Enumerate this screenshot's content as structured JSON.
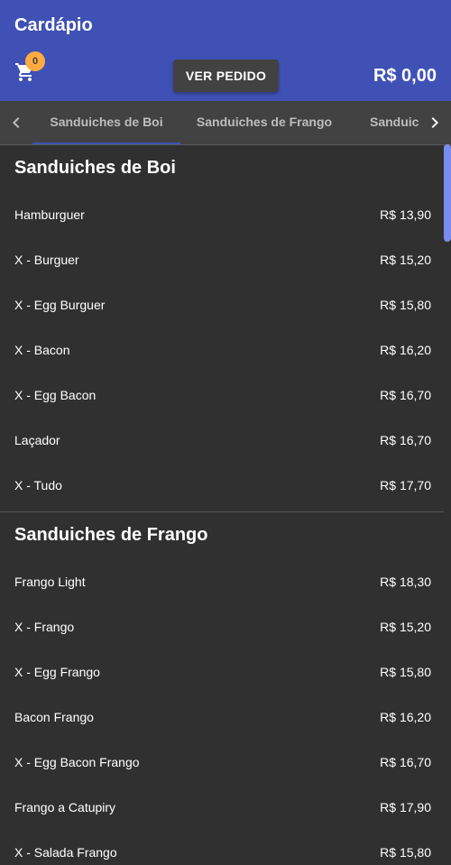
{
  "header": {
    "title": "Cardápio",
    "cart_icon": "cart-icon",
    "cart_count": "0",
    "order_button": "VER PEDIDO",
    "total": "R$ 0,00"
  },
  "tabs": {
    "items": [
      {
        "label": "Sanduiches de Boi",
        "active": true
      },
      {
        "label": "Sanduiches de Frango",
        "active": false
      },
      {
        "label": "Sanduiches",
        "active": false
      }
    ],
    "left_icon": "chevron-left-icon",
    "right_icon": "chevron-right-icon"
  },
  "sections": [
    {
      "title": "Sanduiches de Boi",
      "items": [
        {
          "name": "Hamburguer",
          "price": "R$ 13,90"
        },
        {
          "name": "X - Burguer",
          "price": "R$ 15,20"
        },
        {
          "name": "X - Egg Burguer",
          "price": "R$ 15,80"
        },
        {
          "name": "X - Bacon",
          "price": "R$ 16,20"
        },
        {
          "name": "X - Egg Bacon",
          "price": "R$ 16,70"
        },
        {
          "name": "Laçador",
          "price": "R$ 16,70"
        },
        {
          "name": "X - Tudo",
          "price": "R$ 17,70"
        }
      ]
    },
    {
      "title": "Sanduiches de Frango",
      "items": [
        {
          "name": "Frango Light",
          "price": "R$ 18,30"
        },
        {
          "name": "X - Frango",
          "price": "R$ 15,20"
        },
        {
          "name": "X - Egg Frango",
          "price": "R$ 15,80"
        },
        {
          "name": "Bacon Frango",
          "price": "R$ 16,20"
        },
        {
          "name": "X - Egg Bacon Frango",
          "price": "R$ 16,70"
        },
        {
          "name": "Frango a Catupiry",
          "price": "R$ 17,90"
        },
        {
          "name": "X - Salada Frango",
          "price": "R$ 15,80"
        }
      ]
    }
  ],
  "colors": {
    "primary": "#3f51b5",
    "accent": "#ffab40",
    "background": "#303030",
    "tab_bar": "#424242"
  }
}
